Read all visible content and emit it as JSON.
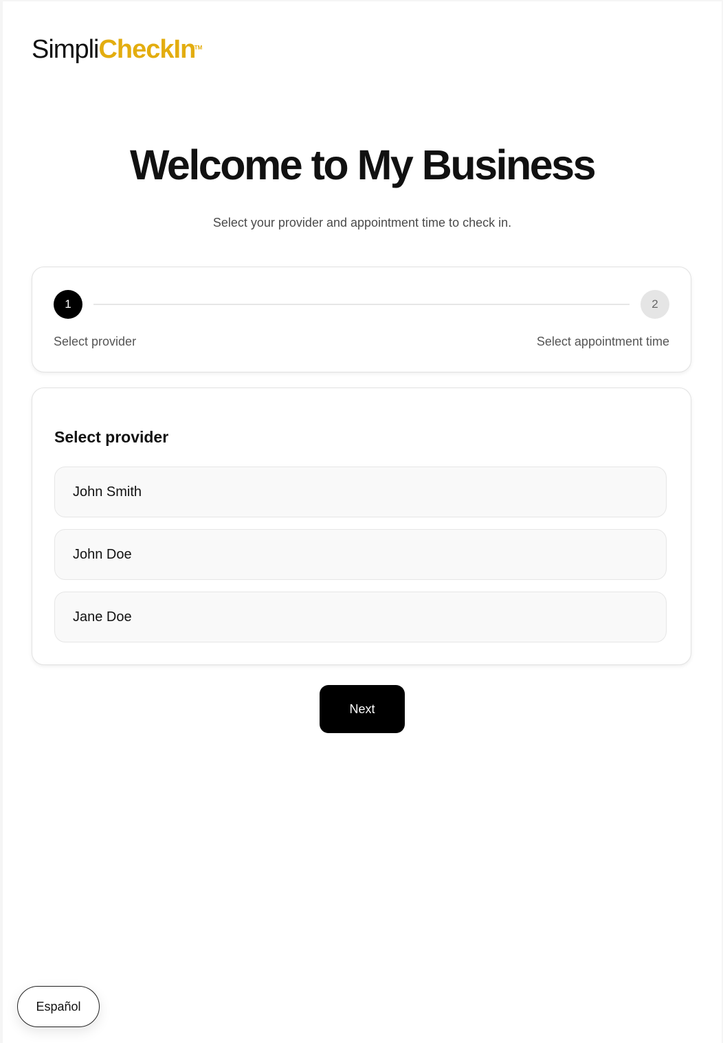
{
  "header": {
    "logo": {
      "part1": "Simpli",
      "part2": "CheckIn",
      "trademark": "TM",
      "accent_color": "#e3ad0f"
    }
  },
  "main": {
    "title": "Welcome to My Business",
    "subtitle": "Select your provider and appointment time to check in."
  },
  "stepper": {
    "current_step": 1,
    "steps": [
      {
        "number": "1",
        "label": "Select provider",
        "state": "active"
      },
      {
        "number": "2",
        "label": "Select appointment time",
        "state": "inactive"
      }
    ]
  },
  "provider_section": {
    "heading": "Select provider",
    "options": [
      {
        "name": "John Smith"
      },
      {
        "name": "John Doe"
      },
      {
        "name": "Jane Doe"
      }
    ]
  },
  "actions": {
    "next_label": "Next"
  },
  "footer": {
    "language_toggle_label": "Español"
  }
}
